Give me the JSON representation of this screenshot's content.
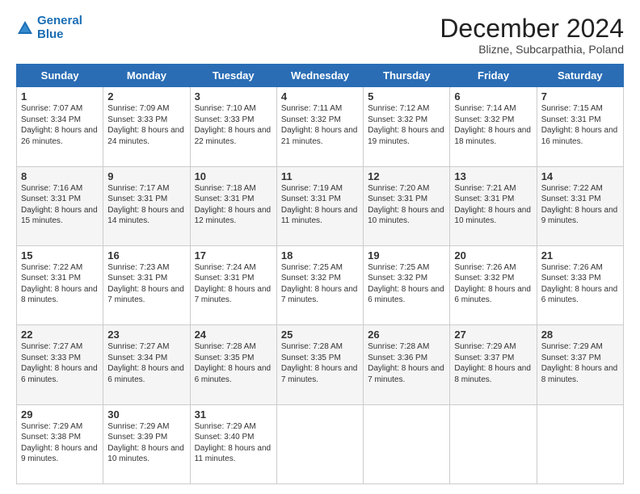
{
  "logo": {
    "line1": "General",
    "line2": "Blue"
  },
  "header": {
    "title": "December 2024",
    "location": "Blizne, Subcarpathia, Poland"
  },
  "weekdays": [
    "Sunday",
    "Monday",
    "Tuesday",
    "Wednesday",
    "Thursday",
    "Friday",
    "Saturday"
  ],
  "weeks": [
    [
      {
        "day": "1",
        "sunrise": "7:07 AM",
        "sunset": "3:34 PM",
        "daylight": "8 hours and 26 minutes."
      },
      {
        "day": "2",
        "sunrise": "7:09 AM",
        "sunset": "3:33 PM",
        "daylight": "8 hours and 24 minutes."
      },
      {
        "day": "3",
        "sunrise": "7:10 AM",
        "sunset": "3:33 PM",
        "daylight": "8 hours and 22 minutes."
      },
      {
        "day": "4",
        "sunrise": "7:11 AM",
        "sunset": "3:32 PM",
        "daylight": "8 hours and 21 minutes."
      },
      {
        "day": "5",
        "sunrise": "7:12 AM",
        "sunset": "3:32 PM",
        "daylight": "8 hours and 19 minutes."
      },
      {
        "day": "6",
        "sunrise": "7:14 AM",
        "sunset": "3:32 PM",
        "daylight": "8 hours and 18 minutes."
      },
      {
        "day": "7",
        "sunrise": "7:15 AM",
        "sunset": "3:31 PM",
        "daylight": "8 hours and 16 minutes."
      }
    ],
    [
      {
        "day": "8",
        "sunrise": "7:16 AM",
        "sunset": "3:31 PM",
        "daylight": "8 hours and 15 minutes."
      },
      {
        "day": "9",
        "sunrise": "7:17 AM",
        "sunset": "3:31 PM",
        "daylight": "8 hours and 14 minutes."
      },
      {
        "day": "10",
        "sunrise": "7:18 AM",
        "sunset": "3:31 PM",
        "daylight": "8 hours and 12 minutes."
      },
      {
        "day": "11",
        "sunrise": "7:19 AM",
        "sunset": "3:31 PM",
        "daylight": "8 hours and 11 minutes."
      },
      {
        "day": "12",
        "sunrise": "7:20 AM",
        "sunset": "3:31 PM",
        "daylight": "8 hours and 10 minutes."
      },
      {
        "day": "13",
        "sunrise": "7:21 AM",
        "sunset": "3:31 PM",
        "daylight": "8 hours and 10 minutes."
      },
      {
        "day": "14",
        "sunrise": "7:22 AM",
        "sunset": "3:31 PM",
        "daylight": "8 hours and 9 minutes."
      }
    ],
    [
      {
        "day": "15",
        "sunrise": "7:22 AM",
        "sunset": "3:31 PM",
        "daylight": "8 hours and 8 minutes."
      },
      {
        "day": "16",
        "sunrise": "7:23 AM",
        "sunset": "3:31 PM",
        "daylight": "8 hours and 7 minutes."
      },
      {
        "day": "17",
        "sunrise": "7:24 AM",
        "sunset": "3:31 PM",
        "daylight": "8 hours and 7 minutes."
      },
      {
        "day": "18",
        "sunrise": "7:25 AM",
        "sunset": "3:32 PM",
        "daylight": "8 hours and 7 minutes."
      },
      {
        "day": "19",
        "sunrise": "7:25 AM",
        "sunset": "3:32 PM",
        "daylight": "8 hours and 6 minutes."
      },
      {
        "day": "20",
        "sunrise": "7:26 AM",
        "sunset": "3:32 PM",
        "daylight": "8 hours and 6 minutes."
      },
      {
        "day": "21",
        "sunrise": "7:26 AM",
        "sunset": "3:33 PM",
        "daylight": "8 hours and 6 minutes."
      }
    ],
    [
      {
        "day": "22",
        "sunrise": "7:27 AM",
        "sunset": "3:33 PM",
        "daylight": "8 hours and 6 minutes."
      },
      {
        "day": "23",
        "sunrise": "7:27 AM",
        "sunset": "3:34 PM",
        "daylight": "8 hours and 6 minutes."
      },
      {
        "day": "24",
        "sunrise": "7:28 AM",
        "sunset": "3:35 PM",
        "daylight": "8 hours and 6 minutes."
      },
      {
        "day": "25",
        "sunrise": "7:28 AM",
        "sunset": "3:35 PM",
        "daylight": "8 hours and 7 minutes."
      },
      {
        "day": "26",
        "sunrise": "7:28 AM",
        "sunset": "3:36 PM",
        "daylight": "8 hours and 7 minutes."
      },
      {
        "day": "27",
        "sunrise": "7:29 AM",
        "sunset": "3:37 PM",
        "daylight": "8 hours and 8 minutes."
      },
      {
        "day": "28",
        "sunrise": "7:29 AM",
        "sunset": "3:37 PM",
        "daylight": "8 hours and 8 minutes."
      }
    ],
    [
      {
        "day": "29",
        "sunrise": "7:29 AM",
        "sunset": "3:38 PM",
        "daylight": "8 hours and 9 minutes."
      },
      {
        "day": "30",
        "sunrise": "7:29 AM",
        "sunset": "3:39 PM",
        "daylight": "8 hours and 10 minutes."
      },
      {
        "day": "31",
        "sunrise": "7:29 AM",
        "sunset": "3:40 PM",
        "daylight": "8 hours and 11 minutes."
      },
      null,
      null,
      null,
      null
    ]
  ]
}
